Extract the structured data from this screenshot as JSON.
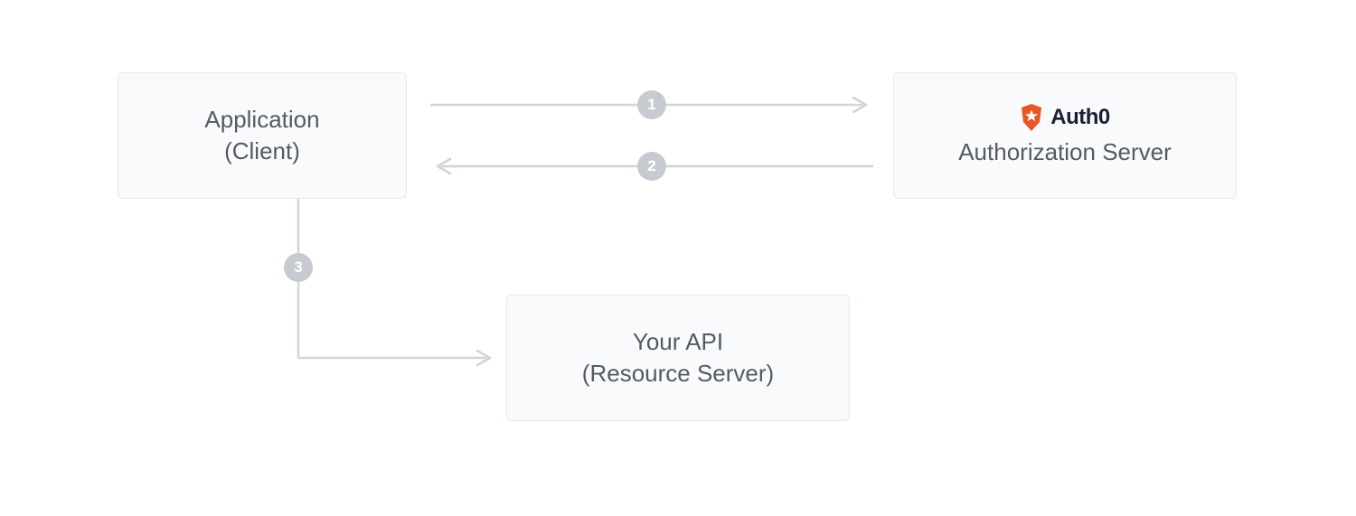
{
  "boxes": {
    "client": {
      "line1": "Application",
      "line2": "(Client)"
    },
    "auth_server": {
      "brand": "Auth0",
      "label": "Authorization Server"
    },
    "api": {
      "line1": "Your API",
      "line2": "(Resource Server)"
    }
  },
  "steps": {
    "one": "1",
    "two": "2",
    "three": "3"
  },
  "colors": {
    "arrow": "#d0d4d9",
    "boxBg": "#f9fafb",
    "boxBorder": "#e5e7ea",
    "badgeBg": "#c7cbd1",
    "brandOrange": "#eb5424"
  }
}
